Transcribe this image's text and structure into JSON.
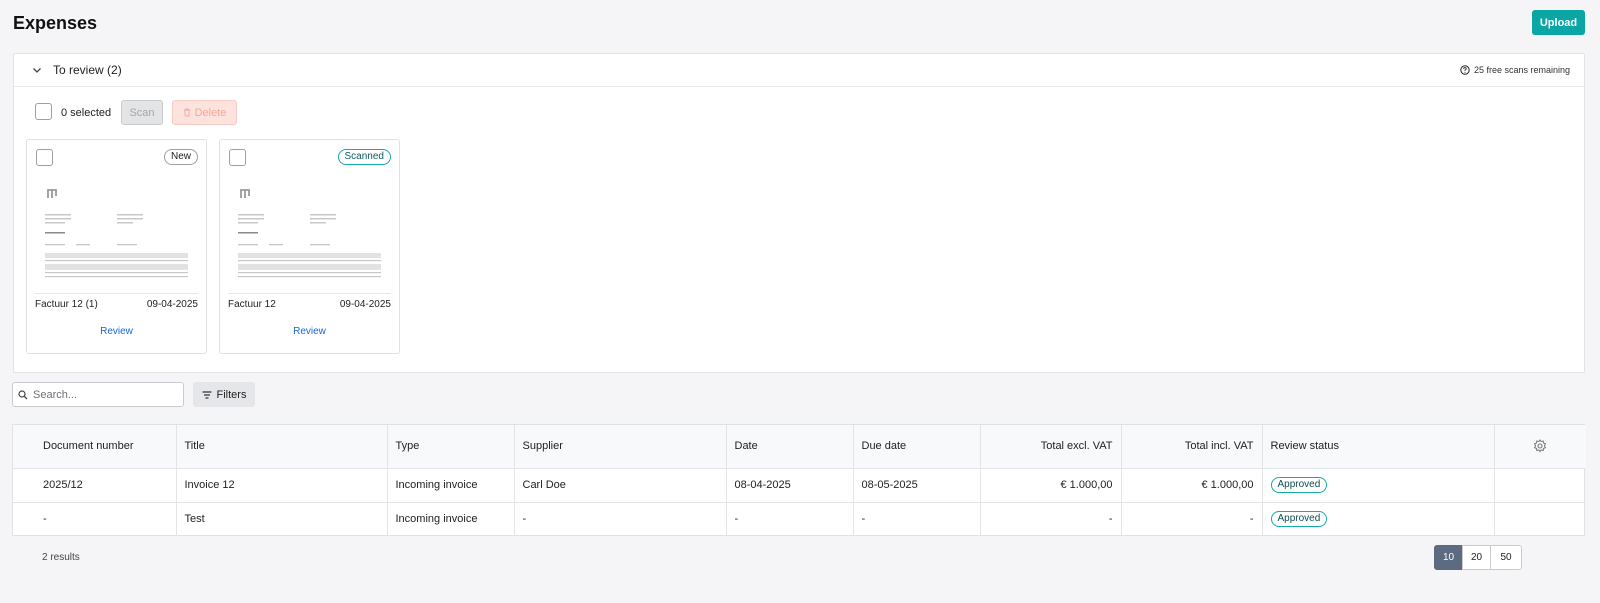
{
  "page": {
    "title": "Expenses",
    "upload_label": "Upload"
  },
  "review": {
    "title": "To review (2)",
    "scans_remaining": "25 free scans remaining",
    "selected": "0 selected",
    "scan_label": "Scan",
    "delete_label": "Delete",
    "cards": [
      {
        "name": "Factuur 12 (1)",
        "date": "09-04-2025",
        "badge": "New",
        "action": "Review"
      },
      {
        "name": "Factuur 12",
        "date": "09-04-2025",
        "badge": "Scanned",
        "action": "Review"
      }
    ]
  },
  "toolbar": {
    "search_placeholder": "Search...",
    "filters_label": "Filters"
  },
  "table": {
    "headers": [
      "Document number",
      "Title",
      "Type",
      "Supplier",
      "Date",
      "Due date",
      "Total excl. VAT",
      "Total incl. VAT",
      "Review status"
    ],
    "rows": [
      {
        "doc": "2025/12",
        "title": "Invoice 12",
        "type": "Incoming invoice",
        "supplier": "Carl Doe",
        "date": "08-04-2025",
        "due": "08-05-2025",
        "excl": "€ 1.000,00",
        "incl": "€ 1.000,00",
        "status": "Approved"
      },
      {
        "doc": "-",
        "title": "Test",
        "type": "Incoming invoice",
        "supplier": "-",
        "date": "-",
        "due": "-",
        "excl": "-",
        "incl": "-",
        "status": "Approved"
      }
    ]
  },
  "footer": {
    "results": "2 results",
    "page_sizes": [
      "10",
      "20",
      "50"
    ],
    "active_page_size": "10"
  },
  "colors": {
    "accent": "#0aa6a6",
    "link": "#1a66d2",
    "pager_active": "#5c6b80"
  }
}
